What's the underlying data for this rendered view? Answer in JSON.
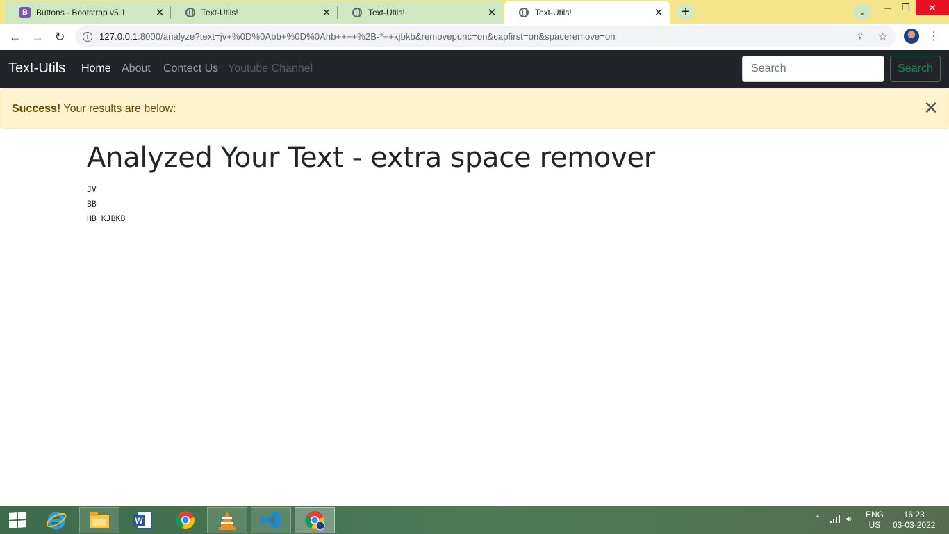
{
  "browser": {
    "tabs": [
      {
        "title": "Buttons · Bootstrap v5.1",
        "favicon": "bootstrap-icon",
        "active": false
      },
      {
        "title": "Text-Utils!",
        "favicon": "globe-icon",
        "active": false
      },
      {
        "title": "Text-Utils!",
        "favicon": "globe-icon",
        "active": false
      },
      {
        "title": "Text-Utils!",
        "favicon": "globe-icon",
        "active": true
      }
    ],
    "url_host": "127.0.0.1",
    "url_rest": ":8000/analyze?text=jv+%0D%0Abb+%0D%0Ahb++++%2B-*++kjbkb&removepunc=on&capfirst=on&spaceremove=on",
    "colors": {
      "tabstrip": "#f4e48a",
      "inactive_tab": "#cfe8c2"
    }
  },
  "navbar": {
    "brand": "Text-Utils",
    "links": [
      {
        "label": "Home",
        "state": "active"
      },
      {
        "label": "About",
        "state": "normal"
      },
      {
        "label": "Contect Us",
        "state": "normal"
      },
      {
        "label": "Youtube Channel",
        "state": "disabled"
      }
    ],
    "search_placeholder": "Search",
    "search_button": "Search",
    "colors": {
      "background": "#212529",
      "search_button": "#198754"
    }
  },
  "alert": {
    "strong": "Success!",
    "message": " Your results are below:",
    "colors": {
      "background": "#fff3cd",
      "text": "#664d03"
    }
  },
  "content": {
    "heading": "Analyzed Your Text - extra space remover",
    "result_lines": [
      "JV",
      "BB",
      "HB KJBKB"
    ]
  },
  "taskbar": {
    "apps": [
      "windows-start",
      "internet-explorer",
      "file-explorer",
      "microsoft-word",
      "google-chrome",
      "vlc-player",
      "vs-code",
      "chrome-profile"
    ],
    "language": "ENG",
    "region": "US",
    "time": "16:23",
    "date": "03-03-2022"
  }
}
